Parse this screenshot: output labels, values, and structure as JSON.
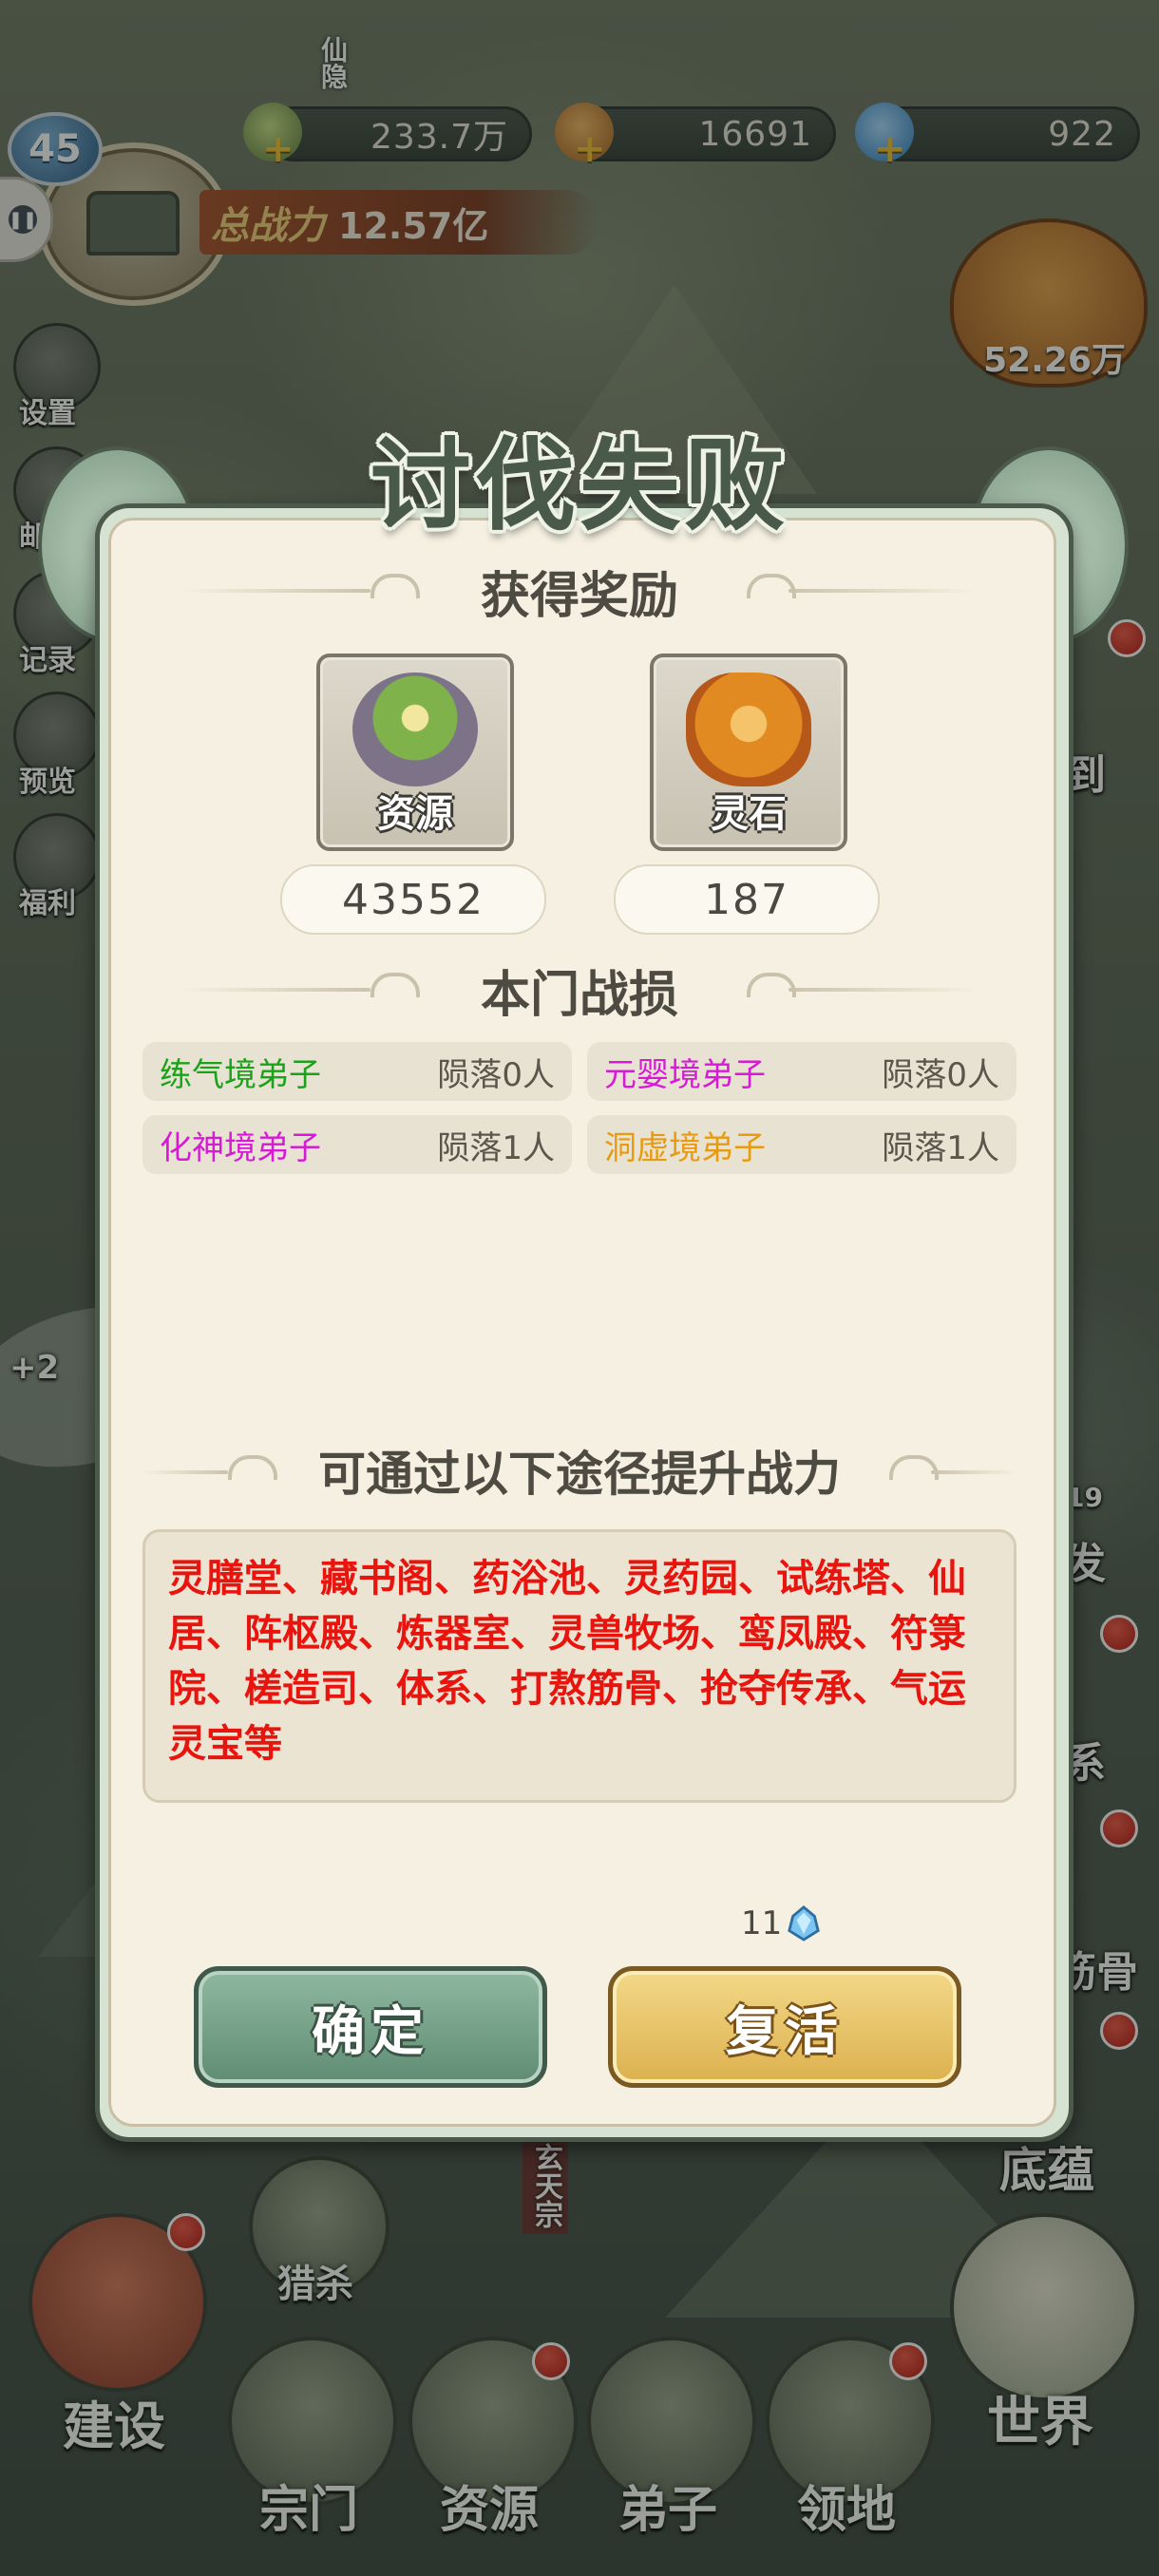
{
  "hud": {
    "level": "45",
    "resources": [
      {
        "name": "resource-herb",
        "value": "233.7万"
      },
      {
        "name": "resource-ore",
        "value": "16691"
      },
      {
        "name": "resource-crystal",
        "value": "922"
      }
    ],
    "plus_symbol": "+",
    "power_label": "总战力",
    "power_value": "12.57亿",
    "pouch_value": "52.26万",
    "map_label_top": "仙隐"
  },
  "left_menu": {
    "settings": "设置",
    "mail": "邮件",
    "record": "记录",
    "preview": "预览",
    "welfare": "福利"
  },
  "right_side": {
    "checkin": "到",
    "start": "发",
    "start_num": "19",
    "system": "系",
    "tempering": "筋骨",
    "foundation": "底蕴"
  },
  "map_labels": {
    "xuantian": "玄天宗",
    "plus_left": "+2"
  },
  "bottom_nav": {
    "hunt": "猎杀",
    "build": "建设",
    "sect": "宗门",
    "resources": "资源",
    "disciples": "弟子",
    "territory": "领地",
    "world": "世界"
  },
  "dialog": {
    "title": "讨伐失败",
    "rewards_header": "获得奖励",
    "rewards": [
      {
        "name": "资源",
        "amount": "43552"
      },
      {
        "name": "灵石",
        "amount": "187"
      }
    ],
    "losses_header": "本门战损",
    "losses": [
      {
        "label": "练气境弟子",
        "value": "陨落0人",
        "color": "#1aa31a"
      },
      {
        "label": "元婴境弟子",
        "value": "陨落0人",
        "color": "#d61ad6"
      },
      {
        "label": "化神境弟子",
        "value": "陨落1人",
        "color": "#d61ad6"
      },
      {
        "label": "洞虚境弟子",
        "value": "陨落1人",
        "color": "#e89a10"
      }
    ],
    "improve_header": "可通过以下途径提升战力",
    "improve_text": "灵膳堂、藏书阁、药浴池、灵药园、试练塔、仙居、阵枢殿、炼器室、灵兽牧场、鸾凤殿、符箓院、槎造司、体系、打熬筋骨、抢夺传承、气运灵宝等",
    "revive_cost": "11",
    "confirm_label": "确定",
    "revive_label": "复活"
  },
  "colors": {
    "confirm": "#6f9c82",
    "revive": "#e6c267",
    "tips_red": "#e8140e"
  }
}
